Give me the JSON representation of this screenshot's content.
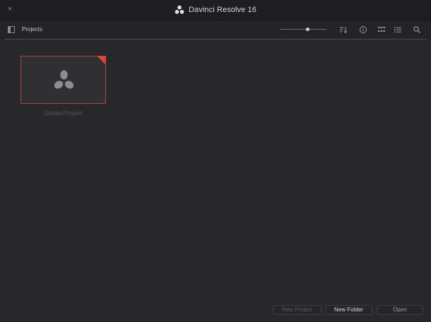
{
  "window": {
    "close_icon": "×",
    "title": "Davinci Resolve 16"
  },
  "toolbar": {
    "breadcrumb": "Projects",
    "thumbnail_zoom": 0.6
  },
  "projects": [
    {
      "name": "Untitled Project",
      "selected": true
    }
  ],
  "footer": {
    "new_project_label": "New Project",
    "new_folder_label": "New Folder",
    "open_label": "Open"
  },
  "colors": {
    "accent_red": "#d9443c",
    "background": "#28282b"
  }
}
